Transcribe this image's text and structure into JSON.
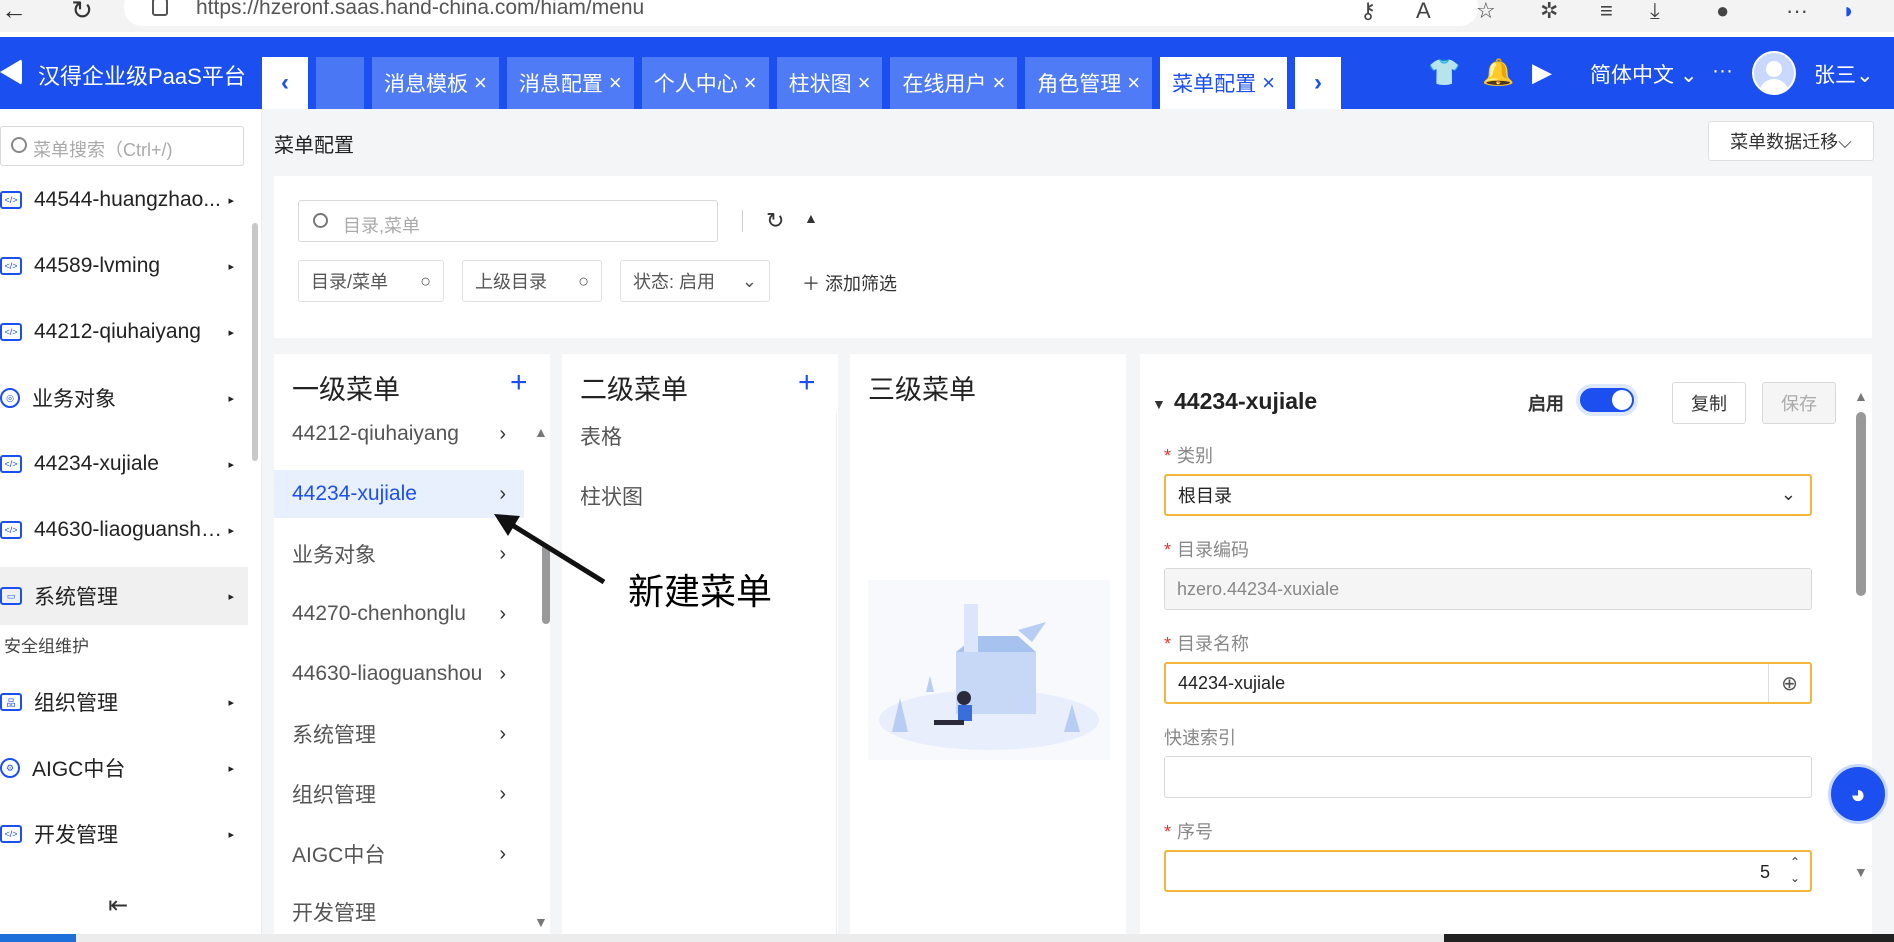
{
  "browser": {
    "url": "https://hzeronf.saas.hand-china.com/hiam/menu"
  },
  "header": {
    "brand": "汉得企业级PaaS平台",
    "tabs": [
      {
        "label": "消息模板",
        "close": "×"
      },
      {
        "label": "消息配置",
        "close": "×"
      },
      {
        "label": "个人中心",
        "close": "×"
      },
      {
        "label": "柱状图",
        "close": "×"
      },
      {
        "label": "在线用户",
        "close": "×"
      },
      {
        "label": "角色管理",
        "close": "×"
      },
      {
        "label": "菜单配置",
        "close": "×",
        "active": true
      }
    ],
    "prev_label": "‹",
    "next_label": "›",
    "language": "简体中文 ⌄",
    "more": "···",
    "user": "张三⌄"
  },
  "sidebar": {
    "search_placeholder": "菜单搜索（Ctrl+/)",
    "items": [
      {
        "label": "44544-huangzhao...",
        "icon": "code-icon"
      },
      {
        "label": "44589-lvming",
        "icon": "code-icon"
      },
      {
        "label": "44212-qiuhaiyang",
        "icon": "code-icon"
      },
      {
        "label": "业务对象",
        "icon": "target-icon"
      },
      {
        "label": "44234-xujiale",
        "icon": "code-icon"
      },
      {
        "label": "44630-liaoguanshou",
        "icon": "code-icon"
      },
      {
        "label": "系统管理",
        "icon": "monitor-icon"
      },
      {
        "label": "组织管理",
        "icon": "org-icon"
      },
      {
        "label": "AIGC中台",
        "icon": "gear-icon"
      },
      {
        "label": "开发管理",
        "icon": "code-icon"
      }
    ],
    "sub_label": "安全组维护",
    "arrow": "▸",
    "collapse": "⇤"
  },
  "main": {
    "page_title": "菜单配置",
    "migrate_button": "菜单数据迁移⌵",
    "filter": {
      "search_placeholder": "目录,菜单",
      "chips": [
        {
          "label": "目录/菜单"
        },
        {
          "label": "上级目录"
        },
        {
          "label": "状态: 启用"
        }
      ],
      "add_filter": "＋ 添加筛选"
    },
    "level1": {
      "title": "一级菜单",
      "plus": "+",
      "items": [
        "44212-qiuhaiyang",
        "44234-xujiale",
        "业务对象",
        "44270-chenhonglu",
        "44630-liaoguanshou",
        "系统管理",
        "组织管理",
        "AIGC中台",
        "开发管理"
      ]
    },
    "level2": {
      "title": "二级菜单",
      "plus": "+",
      "items": [
        "表格",
        "柱状图"
      ]
    },
    "level3": {
      "title": "三级菜单"
    },
    "annotation": "新建菜单",
    "detail": {
      "title": "44234-xujiale",
      "enable_label": "启用",
      "copy_button": "复制",
      "save_button": "保存",
      "fields": {
        "category_label": "类别",
        "category_value": "根目录",
        "code_label": "目录编码",
        "code_value": "hzero.44234-xuxiale",
        "name_label": "目录名称",
        "name_value": "44234-xujiale",
        "quick_index_label": "快速索引",
        "quick_index_value": "",
        "order_label": "序号",
        "order_value": "5"
      }
    }
  }
}
